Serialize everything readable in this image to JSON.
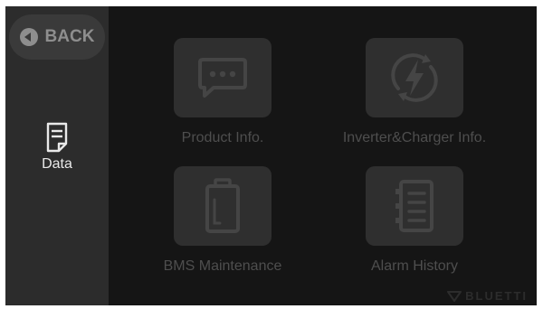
{
  "nav": {
    "back_label": "BACK",
    "active_section_label": "Data"
  },
  "tiles": [
    {
      "label": "Product Info.",
      "icon": "chat-bubble-icon"
    },
    {
      "label": "Inverter&Charger Info.",
      "icon": "lightning-cycle-icon"
    },
    {
      "label": "BMS Maintenance",
      "icon": "battery-icon"
    },
    {
      "label": "Alarm History",
      "icon": "list-document-icon"
    }
  ],
  "brand": {
    "name": "BLUETTI"
  },
  "colors": {
    "screen_bg": "#151515",
    "sidebar_bg": "#2c2c2c",
    "tile_bg": "#2f2f2f",
    "tile_icon": "#454545",
    "tile_label": "#4e4e4e",
    "active_label": "#e9e9e9"
  }
}
